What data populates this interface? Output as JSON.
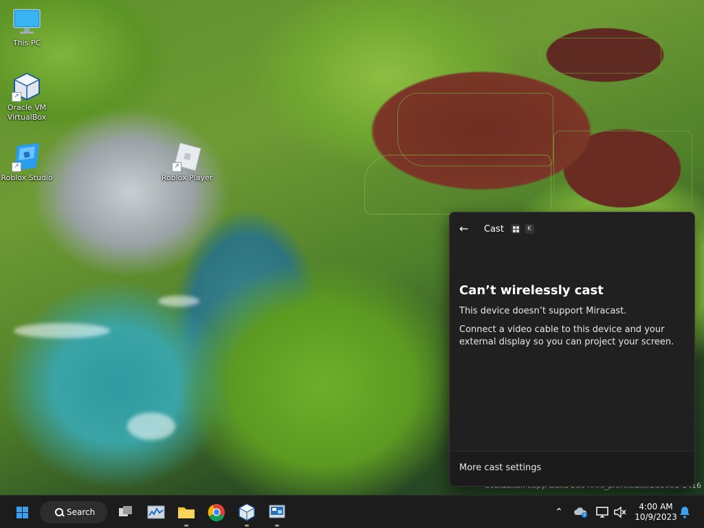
{
  "desktop": {
    "icons": [
      {
        "label": "This PC"
      },
      {
        "label": "Oracle VM VirtualBox"
      },
      {
        "label": "Roblox Studio"
      },
      {
        "label": "Roblox Player"
      }
    ],
    "watermark": "Evaluation copy. Build 25947.rs_prerelease.230901-1416"
  },
  "cast": {
    "title": "Cast",
    "shortcut_key": "K",
    "heading": "Can’t wirelessly cast",
    "message1": "This device doesn’t support Miracast.",
    "message2": "Connect a video cable to this device and your external display so you can project your screen.",
    "more_settings": "More cast settings"
  },
  "taskbar": {
    "search_label": "Search",
    "time": "4:00 AM",
    "date": "10/9/2023"
  },
  "colors": {
    "accent": "#3aa0f0",
    "panel_bg": "#202020",
    "taskbar_bg": "#1c1c1c"
  }
}
